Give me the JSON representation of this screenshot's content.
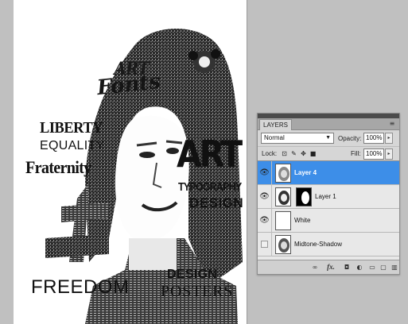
{
  "canvas": {
    "words": {
      "art_small": "ART",
      "fonts": "Fonts",
      "liberty": "LIBERTY",
      "equality": "EQUALITY",
      "fraternity": "Fraternity",
      "art_big": "ART",
      "typography": "TYPOGRAPHY",
      "design_top": "DESIGN",
      "freedom": "FREEDOM",
      "design_bottom": "DESIGN",
      "posters": "POSTERS"
    }
  },
  "layers_panel": {
    "tab_label": "LAYERS",
    "menu_icon": "panel-menu-icon",
    "blend_mode": "Normal",
    "opacity_label": "Opacity:",
    "opacity_value": "100%",
    "lock_label": "Lock:",
    "fill_label": "Fill:",
    "fill_value": "100%",
    "layers": [
      {
        "name": "Layer 4",
        "visible": true,
        "selected": true
      },
      {
        "name": "Layer 1",
        "visible": true,
        "selected": false,
        "has_mask": true
      },
      {
        "name": "White",
        "visible": true,
        "selected": false
      },
      {
        "name": "Midtone-Shadow",
        "visible": false,
        "selected": false
      }
    ],
    "footer_icons": [
      "link-icon",
      "fx-icon",
      "mask-icon",
      "adjustment-icon",
      "folder-icon",
      "new-layer-icon",
      "trash-icon"
    ],
    "selection_color": "#3d8ee8"
  }
}
